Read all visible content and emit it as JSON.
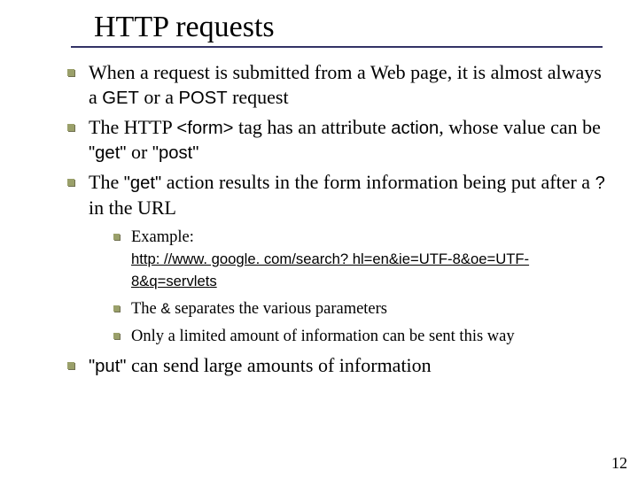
{
  "title": "HTTP requests",
  "bullets": {
    "b1_a": "When a request is submitted from a Web page, it is almost always a ",
    "b1_get": "GET",
    "b1_b": " or a ",
    "b1_post": "POST",
    "b1_c": " request",
    "b2_a": "The HTTP ",
    "b2_form": "<form>",
    "b2_b": " tag has an attribute ",
    "b2_action": "action",
    "b2_c": ", whose value can be ",
    "b2_get": "\"get\"",
    "b2_d": " or ",
    "b2_post": "\"post\"",
    "b3_a": "The ",
    "b3_get": "\"get\"",
    "b3_b": " action results in the form information being put after a ",
    "b3_q": "?",
    "b3_c": " in the URL",
    "b4_put": "\"put\"",
    "b4_a": " can send large amounts of information"
  },
  "sub": {
    "s1_a": "Example:",
    "s1_url_a": "http: //www. google. com/search? hl=en",
    "s1_amp1": "&",
    "s1_url_b": "ie=UTF-8",
    "s1_amp2": "&",
    "s1_url_c": "oe=UTF-8",
    "s1_amp3": "&",
    "s1_url_d": "q=servlets",
    "s2_a": "The ",
    "s2_amp": "&",
    "s2_b": " separates the various parameters",
    "s3": "Only a limited amount of information can be sent this way"
  },
  "page_number": "12"
}
